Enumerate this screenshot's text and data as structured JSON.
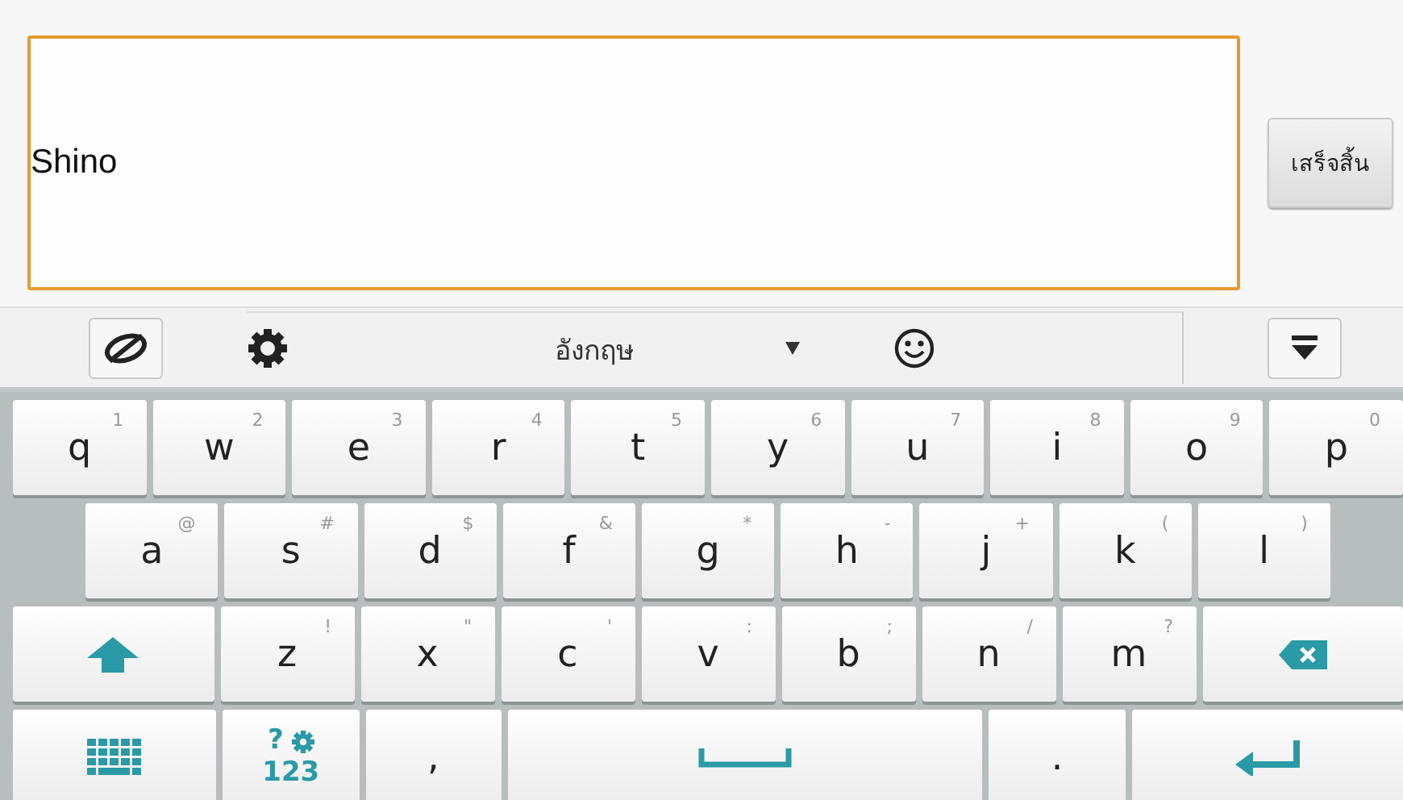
{
  "input": {
    "value": "Shino"
  },
  "done_button": {
    "label": "เสร็จสิ้น"
  },
  "toolbar": {
    "language": "อังกฤษ"
  },
  "keyboard": {
    "rows": [
      {
        "keys": [
          {
            "kind": "char",
            "label": "q",
            "hint": "1"
          },
          {
            "kind": "char",
            "label": "w",
            "hint": "2"
          },
          {
            "kind": "char",
            "label": "e",
            "hint": "3"
          },
          {
            "kind": "char",
            "label": "r",
            "hint": "4"
          },
          {
            "kind": "char",
            "label": "t",
            "hint": "5"
          },
          {
            "kind": "char",
            "label": "y",
            "hint": "6"
          },
          {
            "kind": "char",
            "label": "u",
            "hint": "7"
          },
          {
            "kind": "char",
            "label": "i",
            "hint": "8"
          },
          {
            "kind": "char",
            "label": "o",
            "hint": "9"
          },
          {
            "kind": "char",
            "label": "p",
            "hint": "0"
          }
        ]
      },
      {
        "keys": [
          {
            "kind": "char",
            "label": "a",
            "hint": "@"
          },
          {
            "kind": "char",
            "label": "s",
            "hint": "#"
          },
          {
            "kind": "char",
            "label": "d",
            "hint": "$"
          },
          {
            "kind": "char",
            "label": "f",
            "hint": "&"
          },
          {
            "kind": "char",
            "label": "g",
            "hint": "*"
          },
          {
            "kind": "char",
            "label": "h",
            "hint": "-"
          },
          {
            "kind": "char",
            "label": "j",
            "hint": "+"
          },
          {
            "kind": "char",
            "label": "k",
            "hint": "("
          },
          {
            "kind": "char",
            "label": "l",
            "hint": ")"
          }
        ]
      },
      {
        "keys": [
          {
            "kind": "shift"
          },
          {
            "kind": "char",
            "label": "z",
            "hint": "!"
          },
          {
            "kind": "char",
            "label": "x",
            "hint": "\""
          },
          {
            "kind": "char",
            "label": "c",
            "hint": "'"
          },
          {
            "kind": "char",
            "label": "v",
            "hint": ":"
          },
          {
            "kind": "char",
            "label": "b",
            "hint": ";"
          },
          {
            "kind": "char",
            "label": "n",
            "hint": "/"
          },
          {
            "kind": "char",
            "label": "m",
            "hint": "?"
          },
          {
            "kind": "backspace"
          }
        ]
      },
      {
        "keys": [
          {
            "kind": "layout"
          },
          {
            "kind": "symbols",
            "label": "?",
            "sublabel": "123"
          },
          {
            "kind": "char",
            "label": ","
          },
          {
            "kind": "space"
          },
          {
            "kind": "char",
            "label": "."
          },
          {
            "kind": "enter"
          }
        ]
      }
    ]
  }
}
